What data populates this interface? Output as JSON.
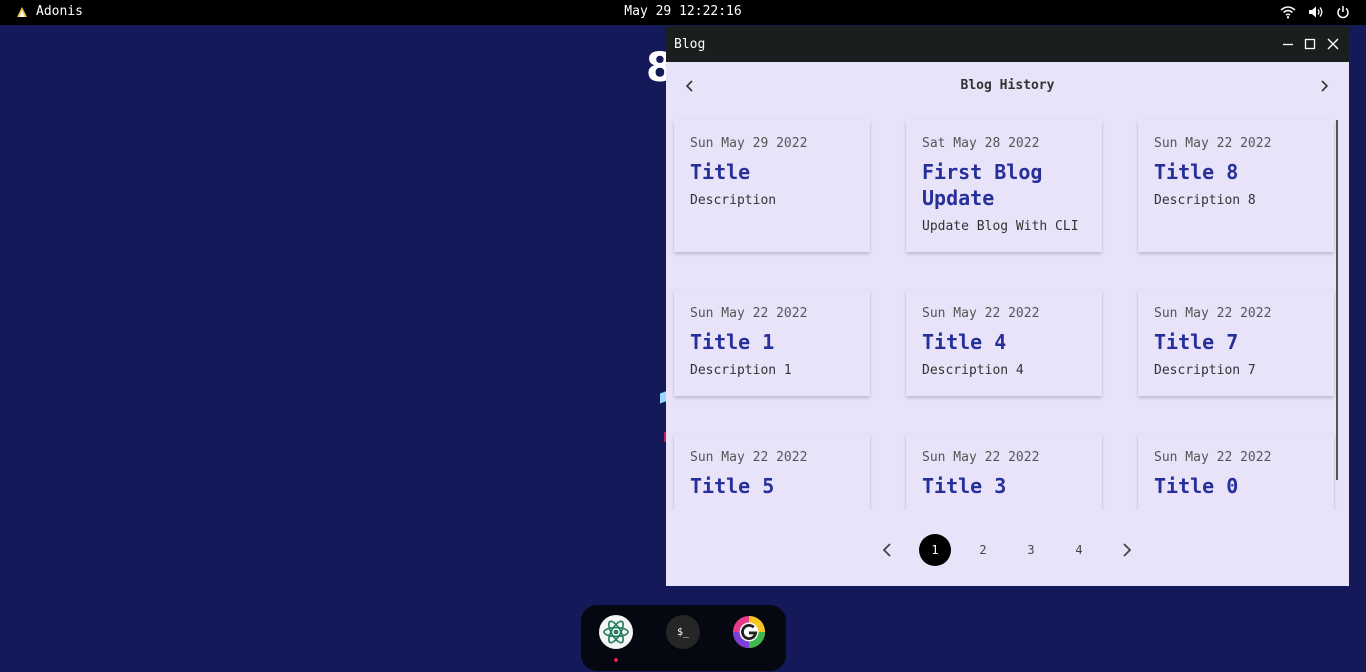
{
  "topbar": {
    "app_name": "Adonis",
    "clock": "May 29 12:22:16",
    "icons": [
      "wifi-icon",
      "volume-icon",
      "power-icon"
    ]
  },
  "window": {
    "title": "Blog",
    "heading": "Blog History",
    "cards": [
      {
        "date": "Sun May 29 2022",
        "title": "Title",
        "description": "Description"
      },
      {
        "date": "Sat May 28 2022",
        "title": "First Blog Update",
        "description": "Update Blog With CLI"
      },
      {
        "date": "Sun May 22 2022",
        "title": "Title 8",
        "description": "Description 8"
      },
      {
        "date": "Sun May 22 2022",
        "title": "Title 1",
        "description": "Description 1"
      },
      {
        "date": "Sun May 22 2022",
        "title": "Title 4",
        "description": "Description 4"
      },
      {
        "date": "Sun May 22 2022",
        "title": "Title 7",
        "description": "Description 7"
      },
      {
        "date": "Sun May 22 2022",
        "title": "Title 5",
        "description": ""
      },
      {
        "date": "Sun May 22 2022",
        "title": "Title 3",
        "description": ""
      },
      {
        "date": "Sun May 22 2022",
        "title": "Title 0",
        "description": ""
      }
    ],
    "pagination": {
      "pages": [
        "1",
        "2",
        "3",
        "4"
      ],
      "current": "1"
    }
  },
  "wallpaper": {
    "glyph": "8"
  },
  "dock": {
    "apps": [
      "atom-icon",
      "terminal-icon",
      "g-app-icon"
    ],
    "terminal_glyph": "$_"
  },
  "colors": {
    "desktop": "#141a59",
    "window_bg": "#e8e3f9",
    "card_title": "#27309a",
    "titlebar": "#1b1e1f"
  }
}
